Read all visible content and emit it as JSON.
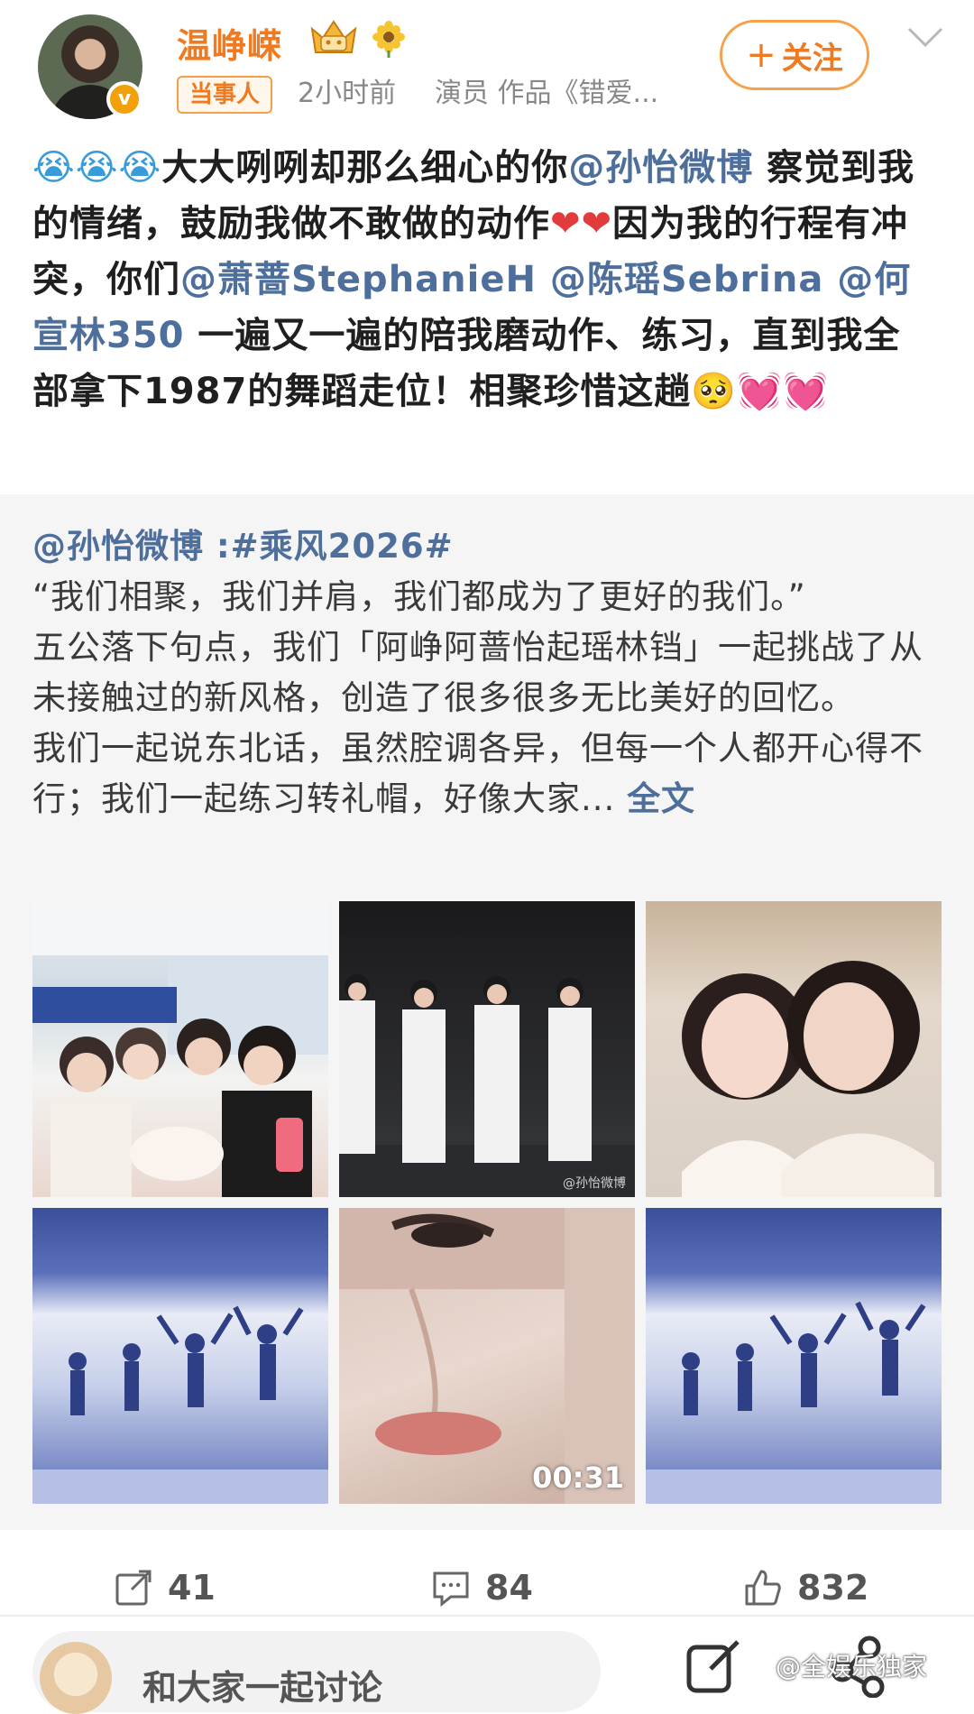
{
  "author": {
    "name": "温峥嵘",
    "verified_mark": "v",
    "tag": "当事人",
    "time": "2小时前",
    "source": "演员 作品《错爱..."
  },
  "follow_button": {
    "plus": "+",
    "label": "关注"
  },
  "post": {
    "emoji_cry": "😭😭😭",
    "text1": "大大咧咧却那么细心的你",
    "mention1": "@孙怡微博",
    "text2": " 察觉到我的情绪，鼓励我做不敢做的动作",
    "hearts": "❤❤",
    "text3": "因为我的行程有冲突，你们",
    "mention2": "@萧蔷StephanieH",
    "mention3": " @陈瑶Sebrina",
    "mention4": " @何宣林350",
    "text4": "  一遍又一遍的陪我磨动作、练习，直到我全部拿下1987的舞蹈走位！相聚珍惜这趟",
    "emoji_end": "🥺💓💓"
  },
  "repost": {
    "author": "@孙怡微博",
    "topic": " :#乘风2026#",
    "para1": "“我们相聚，我们并肩，我们都成为了更好的我们。”",
    "para2": "五公落下句点，我们「阿峥阿蔷怡起瑶林铛」一起挑战了从未接触过的新风格，创造了很多很多无比美好的回忆。",
    "para3": "我们一起说东北话，虽然腔调各异，但每一个人都开心得不行；我们一起练习转礼帽，好像大家...",
    "full_text_link": "全文",
    "image_watermark": "@孙怡微博",
    "video_duration": "00:31"
  },
  "actions": {
    "share_count": "41",
    "comment_count": "84",
    "like_count": "832"
  },
  "bottom": {
    "comment_placeholder": "和大家一起讨论",
    "watermark": "@全娱乐独家"
  },
  "colors": {
    "username": "#f07a1f",
    "mention": "#4e6f9c",
    "repost_bg": "#f5f5f5"
  }
}
